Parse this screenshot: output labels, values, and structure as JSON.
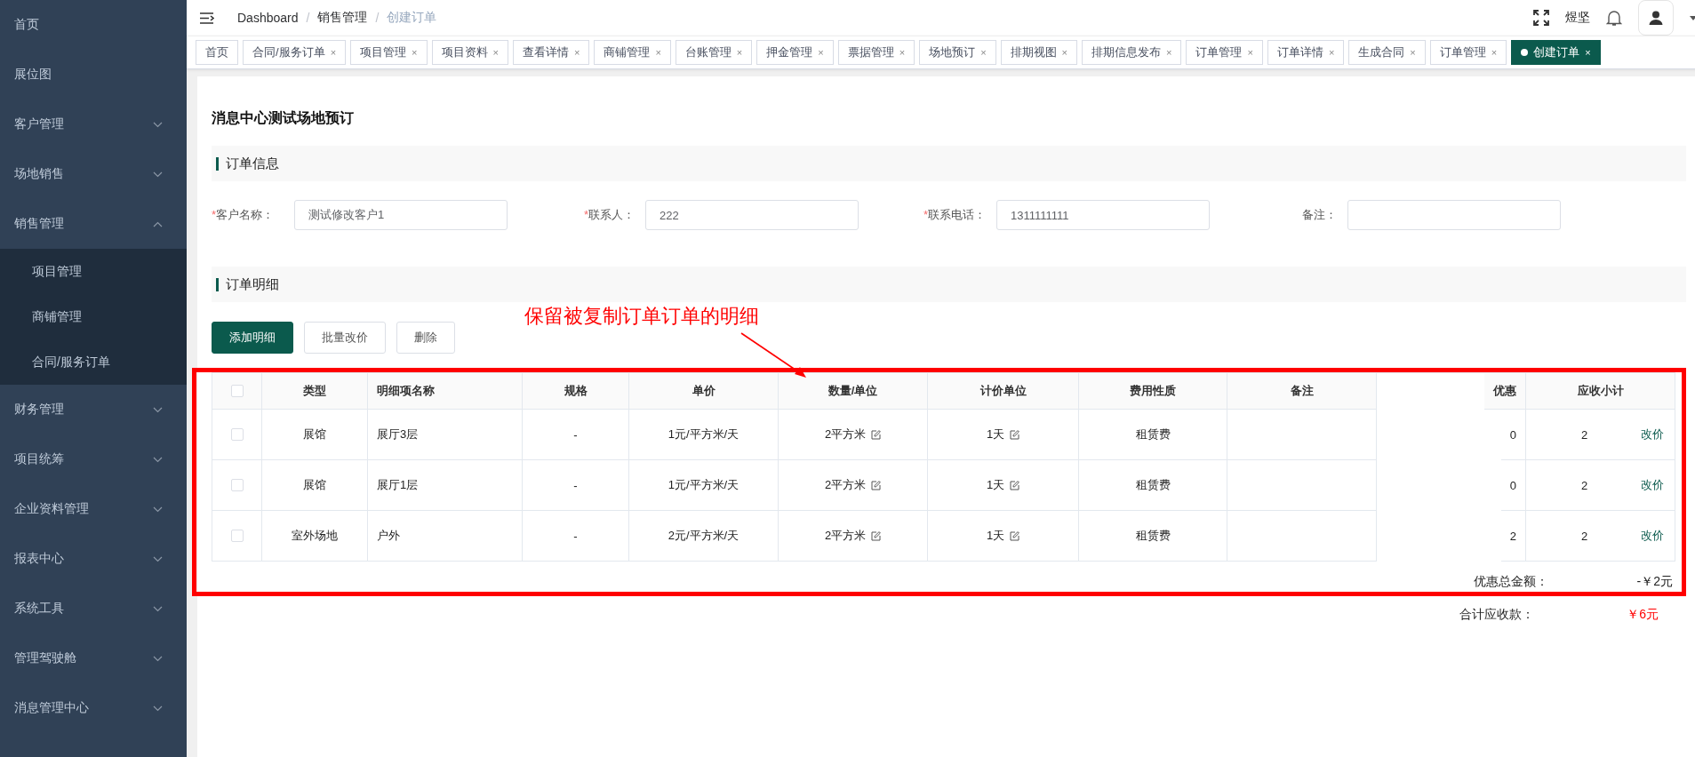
{
  "sidebar": {
    "items": [
      {
        "label": "首页"
      },
      {
        "label": "展位图"
      },
      {
        "label": "客户管理",
        "expanded": false
      },
      {
        "label": "场地销售",
        "expanded": false
      },
      {
        "label": "销售管理",
        "expanded": true,
        "children": [
          {
            "label": "项目管理"
          },
          {
            "label": "商铺管理"
          },
          {
            "label": "合同/服务订单"
          }
        ]
      },
      {
        "label": "财务管理",
        "expanded": false
      },
      {
        "label": "项目统筹",
        "expanded": false
      },
      {
        "label": "企业资料管理",
        "expanded": false
      },
      {
        "label": "报表中心",
        "expanded": false
      },
      {
        "label": "系统工具",
        "expanded": false
      },
      {
        "label": "管理驾驶舱",
        "expanded": false
      },
      {
        "label": "消息管理中心",
        "expanded": false
      }
    ]
  },
  "header": {
    "breadcrumb": [
      {
        "label": "Dashboard",
        "kind": "link"
      },
      {
        "label": "销售管理",
        "kind": "link"
      },
      {
        "label": "创建订单",
        "kind": "current"
      }
    ],
    "separator": "/",
    "user": "煜坚"
  },
  "tabs": [
    {
      "label": "首页",
      "selected": false
    },
    {
      "label": "合同/服务订单",
      "close": "×",
      "selected": false
    },
    {
      "label": "项目管理",
      "close": "×",
      "selected": false
    },
    {
      "label": "项目资料",
      "close": "×",
      "selected": false
    },
    {
      "label": "查看详情",
      "close": "×",
      "selected": false
    },
    {
      "label": "商铺管理",
      "close": "×",
      "selected": false
    },
    {
      "label": "台账管理",
      "close": "×",
      "selected": false
    },
    {
      "label": "押金管理",
      "close": "×",
      "selected": false
    },
    {
      "label": "票据管理",
      "close": "×",
      "selected": false
    },
    {
      "label": "场地预订",
      "close": "×",
      "selected": false
    },
    {
      "label": "排期视图",
      "close": "×",
      "selected": false
    },
    {
      "label": "排期信息发布",
      "close": "×",
      "selected": false
    },
    {
      "label": "订单管理",
      "close": "×",
      "selected": false
    },
    {
      "label": "订单详情",
      "close": "×",
      "selected": false
    },
    {
      "label": "生成合同",
      "close": "×",
      "selected": false
    },
    {
      "label": "订单管理",
      "close": "×",
      "selected": false
    },
    {
      "label": "创建订单",
      "close": "×",
      "selected": true
    }
  ],
  "page": {
    "title": "消息中心测试场地预订",
    "order_info": {
      "heading": "订单信息",
      "fields": [
        {
          "mark": "*",
          "label": "客户名称：",
          "value": "测试修改客户1"
        },
        {
          "mark": "*",
          "label": "联系人：",
          "value": "222"
        },
        {
          "mark": "*",
          "label": "联系电话：",
          "value": "1311111111"
        },
        {
          "label": "备注："
        }
      ]
    },
    "order_details": {
      "heading": "订单明细",
      "buttons": [
        {
          "label": "添加明细",
          "kind": "primary"
        },
        {
          "label": "批量改价",
          "kind": "default"
        },
        {
          "label": "删除",
          "kind": "default"
        }
      ],
      "table": {
        "header_checked": false,
        "columns": [
          "类型",
          "明细项名称",
          "规格",
          "单价",
          "数量/单位",
          "计价单位",
          "费用性质",
          "备注",
          "优惠",
          "应收小计"
        ],
        "rows": [
          {
            "checked": false,
            "type": "展馆",
            "name": "展厅3层",
            "spec": "-",
            "price": "1元/平方米/天",
            "quantity": "2平方米",
            "unit": "1天",
            "fee_type": "租赁费",
            "discount": "0",
            "subtotal": "2",
            "action": "改价"
          },
          {
            "checked": false,
            "type": "展馆",
            "name": "展厅1层",
            "spec": "-",
            "price": "1元/平方米/天",
            "quantity": "2平方米",
            "unit": "1天",
            "fee_type": "租赁费",
            "discount": "0",
            "subtotal": "2",
            "action": "改价"
          },
          {
            "checked": false,
            "type": "室外场地",
            "name": "户外",
            "spec": "-",
            "price": "2元/平方米/天",
            "quantity": "2平方米",
            "unit": "1天",
            "fee_type": "租赁费",
            "discount": "2",
            "subtotal": "2",
            "action": "改价"
          }
        ]
      },
      "totals": [
        {
          "label": "优惠总金额：",
          "value": "-￥2元",
          "kind": "discount"
        },
        {
          "label": "合计应收款：",
          "value": "￥6元",
          "kind": "total"
        }
      ]
    }
  },
  "annotation": {
    "text": "保留被复制订单订单的明细"
  }
}
